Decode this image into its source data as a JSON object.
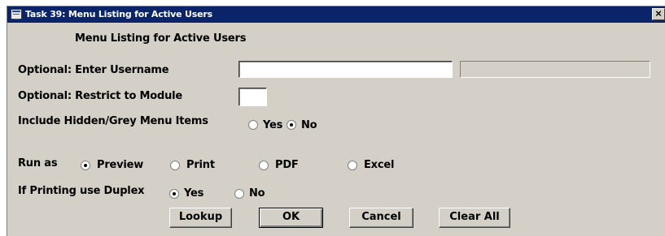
{
  "window": {
    "title": "Task 39: Menu Listing for Active Users",
    "close_glyph": "×"
  },
  "form": {
    "heading": "Menu Listing for Active Users",
    "username_label": "Optional:  Enter Username",
    "username_value": "",
    "module_label": "Optional: Restrict to Module",
    "module_value": "",
    "hidden_label": "Include Hidden/Grey Menu Items",
    "hidden_options": [
      {
        "label": "Yes",
        "checked": false
      },
      {
        "label": "No",
        "checked": true
      }
    ],
    "run_as_label": "Run as",
    "run_as_options": [
      {
        "label": "Preview",
        "checked": true
      },
      {
        "label": "Print",
        "checked": false
      },
      {
        "label": "PDF",
        "checked": false
      },
      {
        "label": "Excel",
        "checked": false
      }
    ],
    "duplex_label": "If Printing use Duplex",
    "duplex_options": [
      {
        "label": "Yes",
        "checked": true
      },
      {
        "label": "No",
        "checked": false
      }
    ]
  },
  "buttons": {
    "lookup": "Lookup",
    "ok": "OK",
    "cancel": "Cancel",
    "clear_all": "Clear All"
  }
}
